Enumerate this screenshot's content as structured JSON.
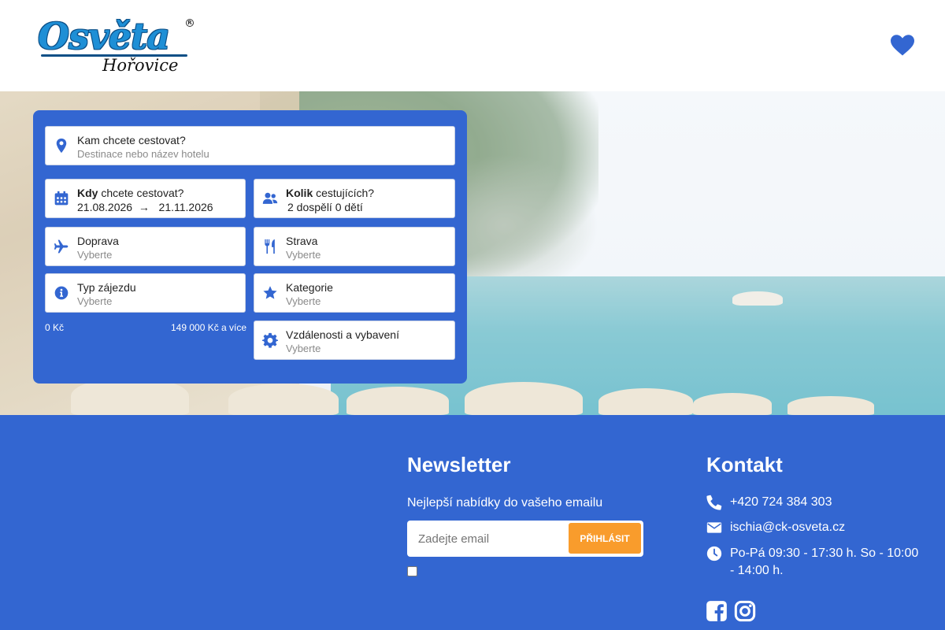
{
  "header": {
    "logo_main": "Osvěta",
    "logo_sub": "Hořovice",
    "logo_reg": "R"
  },
  "search": {
    "destination": {
      "label": "Kam chcete cestovat?",
      "placeholder": "Destinace nebo název hotelu"
    },
    "dates": {
      "label_bold": "Kdy",
      "label_rest": " chcete cestovat?",
      "from": "21.08.2026",
      "arrow": "→",
      "to": "21.11.2026"
    },
    "travelers": {
      "label_bold": "Kolik",
      "label_rest": " cestujících?",
      "value": "2 dospělí 0 dětí"
    },
    "transport": {
      "label": "Doprava",
      "placeholder": "Vyberte"
    },
    "board": {
      "label": "Strava",
      "placeholder": "Vyberte"
    },
    "tour_type": {
      "label": "Typ zájezdu",
      "placeholder": "Vyberte"
    },
    "category": {
      "label": "Kategorie",
      "placeholder": "Vyberte"
    },
    "distances": {
      "label": "Vzdálenosti a vybavení",
      "placeholder": "Vyberte"
    },
    "price_min": "0 Kč",
    "price_max": "149 000 Kč a více"
  },
  "newsletter": {
    "title": "Newsletter",
    "description": "Nejlepší nabídky do vašeho emailu",
    "placeholder": "Zadejte email",
    "button": "PŘIHLÁSIT"
  },
  "contact": {
    "title": "Kontakt",
    "phone": "+420 724 384 303",
    "email": "ischia@ck-osveta.cz",
    "hours": "Po-Pá 09:30 - 17:30 h. So - 10:00 - 14:00 h."
  },
  "colors": {
    "brand_blue": "#3366d1",
    "accent_orange": "#f99c2c"
  },
  "icons": [
    "heart-icon",
    "map-pin-icon",
    "calendar-icon",
    "users-icon",
    "plane-icon",
    "utensils-icon",
    "info-icon",
    "star-icon",
    "gear-icon",
    "phone-icon",
    "envelope-icon",
    "clock-icon",
    "facebook-icon",
    "instagram-icon"
  ]
}
